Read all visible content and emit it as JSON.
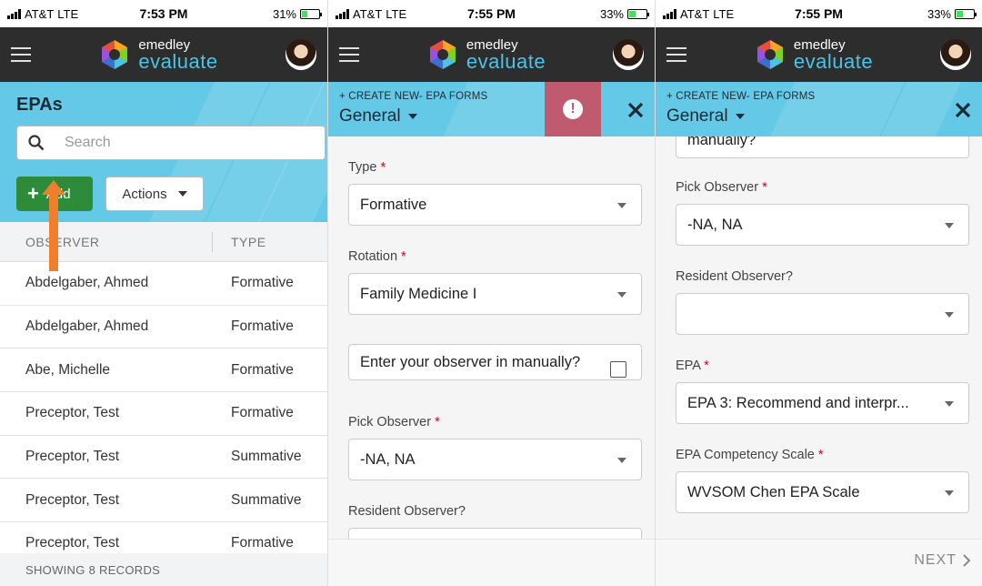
{
  "screens": [
    {
      "status": {
        "carrier": "AT&T",
        "network": "LTE",
        "time": "7:53 PM",
        "battery": "31%"
      },
      "brand": {
        "line1": "emedley",
        "line2": "evaluate"
      },
      "title": "EPAs",
      "search_placeholder": "Search",
      "add_label": "Add",
      "actions_label": "Actions",
      "columns": [
        "OBSERVER",
        "TYPE"
      ],
      "rows": [
        [
          "Abdelgaber, Ahmed",
          "Formative"
        ],
        [
          "Abdelgaber, Ahmed",
          "Formative"
        ],
        [
          "Abe, Michelle",
          "Formative"
        ],
        [
          "Preceptor, Test",
          "Formative"
        ],
        [
          "Preceptor, Test",
          "Summative"
        ],
        [
          "Preceptor, Test",
          "Summative"
        ],
        [
          "Preceptor, Test",
          "Formative"
        ]
      ],
      "footer": "SHOWING 8 RECORDS"
    },
    {
      "status": {
        "carrier": "AT&T",
        "network": "LTE",
        "time": "7:55 PM",
        "battery": "33%"
      },
      "brand": {
        "line1": "emedley",
        "line2": "evaluate"
      },
      "create_new": "+ CREATE NEW- EPA FORMS",
      "section": "General",
      "fields": {
        "type_label": "Type",
        "type_value": "Formative",
        "rotation_label": "Rotation",
        "rotation_value": "Family Medicine I",
        "manual_label": "Enter your observer in manually?",
        "pick_label": "Pick Observer",
        "pick_value": "-NA, NA",
        "resident_label": "Resident Observer?"
      }
    },
    {
      "status": {
        "carrier": "AT&T",
        "network": "LTE",
        "time": "7:55 PM",
        "battery": "33%"
      },
      "brand": {
        "line1": "emedley",
        "line2": "evaluate"
      },
      "create_new": "+ CREATE NEW- EPA FORMS",
      "section": "General",
      "fields": {
        "manual_tail": "manually?",
        "pick_label": "Pick Observer",
        "pick_value": "-NA, NA",
        "resident_label": "Resident Observer?",
        "epa_label": "EPA",
        "epa_value": "EPA 3: Recommend and interpr...",
        "scale_label": "EPA Competency Scale",
        "scale_value": "WVSOM Chen EPA Scale"
      },
      "next_label": "NEXT"
    }
  ],
  "colors": {
    "band": "#63c9e6",
    "appbar": "#2d2d2d",
    "add_button": "#2e8b3a",
    "alert": "#c05a6f",
    "arrow": "#f07f2c",
    "required": "#d0021b"
  }
}
